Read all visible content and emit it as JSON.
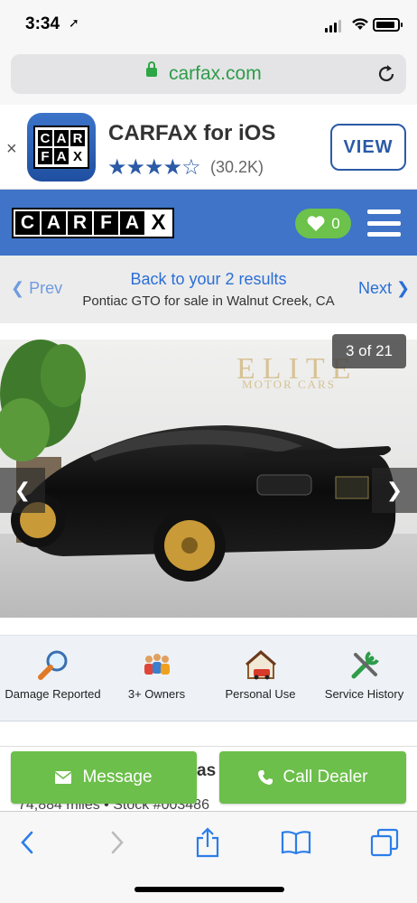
{
  "status_bar": {
    "time": "3:34"
  },
  "browser": {
    "domain": "carfax.com"
  },
  "app_banner": {
    "app_name": "CARFAX for iOS",
    "stars": "★★★★☆",
    "rating_count": "(30.2K)",
    "view_label": "VIEW",
    "close_glyph": "×",
    "logo_letters": [
      "C",
      "A",
      "R",
      "F",
      "A",
      "X"
    ]
  },
  "header": {
    "logo_letters": [
      "C",
      "A",
      "R",
      "F",
      "A",
      "X"
    ],
    "favorites_count": "0"
  },
  "results_nav": {
    "prev_label": "Prev",
    "next_label": "Next",
    "back_label": "Back to your 2 results",
    "subtitle": "Pontiac GTO for sale in Walnut Creek, CA"
  },
  "gallery": {
    "counter": "3 of 21",
    "watermark_line1": "ELITE",
    "watermark_line2": "MOTOR CARS"
  },
  "features": [
    {
      "icon": "magnifier-icon",
      "label": "Damage Reported"
    },
    {
      "icon": "owners-icon",
      "label": "3+ Owners"
    },
    {
      "icon": "house-car-icon",
      "label": "Personal Use"
    },
    {
      "icon": "tools-icon",
      "label": "Service History"
    }
  ],
  "listing": {
    "title_fragment": "as",
    "meta": "74,884 miles  •  Stock #003486"
  },
  "actions": {
    "message_label": "Message",
    "call_label": "Call Dealer"
  },
  "colors": {
    "brand_blue": "#3f74c8",
    "green": "#6cbf4a",
    "link_blue": "#2b6ed6"
  }
}
